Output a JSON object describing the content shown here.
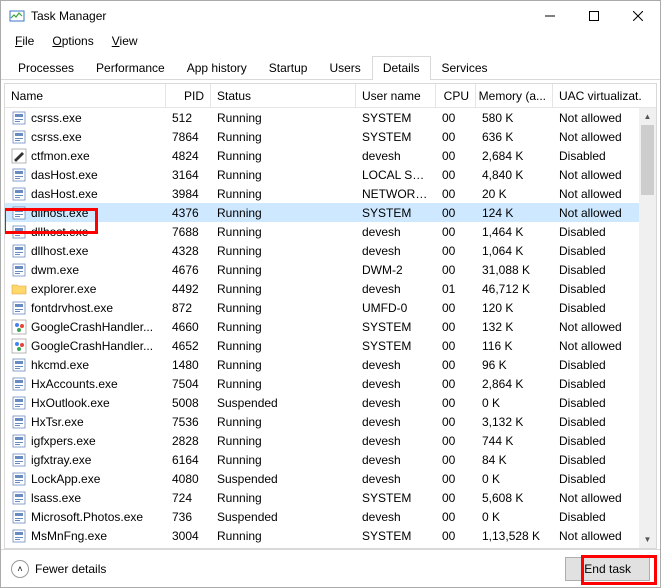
{
  "window": {
    "title": "Task Manager"
  },
  "menu": {
    "file": "File",
    "options": "Options",
    "view": "View"
  },
  "tabs": {
    "processes": "Processes",
    "performance": "Performance",
    "apphistory": "App history",
    "startup": "Startup",
    "users": "Users",
    "details": "Details",
    "services": "Services"
  },
  "columns": {
    "name": "Name",
    "pid": "PID",
    "status": "Status",
    "user": "User name",
    "cpu": "CPU",
    "mem": "Memory (a...",
    "uac": "UAC virtualizat..."
  },
  "rows": [
    {
      "icon": "exe",
      "name": "csrss.exe",
      "pid": "512",
      "status": "Running",
      "user": "SYSTEM",
      "cpu": "00",
      "mem": "580 K",
      "uac": "Not allowed"
    },
    {
      "icon": "exe",
      "name": "csrss.exe",
      "pid": "7864",
      "status": "Running",
      "user": "SYSTEM",
      "cpu": "00",
      "mem": "636 K",
      "uac": "Not allowed"
    },
    {
      "icon": "pen",
      "name": "ctfmon.exe",
      "pid": "4824",
      "status": "Running",
      "user": "devesh",
      "cpu": "00",
      "mem": "2,684 K",
      "uac": "Disabled"
    },
    {
      "icon": "exe",
      "name": "dasHost.exe",
      "pid": "3164",
      "status": "Running",
      "user": "LOCAL SE...",
      "cpu": "00",
      "mem": "4,840 K",
      "uac": "Not allowed"
    },
    {
      "icon": "exe",
      "name": "dasHost.exe",
      "pid": "3984",
      "status": "Running",
      "user": "NETWORK...",
      "cpu": "00",
      "mem": "20 K",
      "uac": "Not allowed"
    },
    {
      "icon": "exe",
      "name": "dllhost.exe",
      "pid": "4376",
      "status": "Running",
      "user": "SYSTEM",
      "cpu": "00",
      "mem": "124 K",
      "uac": "Not allowed",
      "selected": true
    },
    {
      "icon": "exe",
      "name": "dllhost.exe",
      "pid": "7688",
      "status": "Running",
      "user": "devesh",
      "cpu": "00",
      "mem": "1,464 K",
      "uac": "Disabled"
    },
    {
      "icon": "exe",
      "name": "dllhost.exe",
      "pid": "4328",
      "status": "Running",
      "user": "devesh",
      "cpu": "00",
      "mem": "1,064 K",
      "uac": "Disabled"
    },
    {
      "icon": "exe",
      "name": "dwm.exe",
      "pid": "4676",
      "status": "Running",
      "user": "DWM-2",
      "cpu": "00",
      "mem": "31,088 K",
      "uac": "Disabled"
    },
    {
      "icon": "folder",
      "name": "explorer.exe",
      "pid": "4492",
      "status": "Running",
      "user": "devesh",
      "cpu": "01",
      "mem": "46,712 K",
      "uac": "Disabled"
    },
    {
      "icon": "exe",
      "name": "fontdrvhost.exe",
      "pid": "872",
      "status": "Running",
      "user": "UMFD-0",
      "cpu": "00",
      "mem": "120 K",
      "uac": "Disabled"
    },
    {
      "icon": "color",
      "name": "GoogleCrashHandler...",
      "pid": "4660",
      "status": "Running",
      "user": "SYSTEM",
      "cpu": "00",
      "mem": "132 K",
      "uac": "Not allowed"
    },
    {
      "icon": "color",
      "name": "GoogleCrashHandler...",
      "pid": "4652",
      "status": "Running",
      "user": "SYSTEM",
      "cpu": "00",
      "mem": "116 K",
      "uac": "Not allowed"
    },
    {
      "icon": "exe",
      "name": "hkcmd.exe",
      "pid": "1480",
      "status": "Running",
      "user": "devesh",
      "cpu": "00",
      "mem": "96 K",
      "uac": "Disabled"
    },
    {
      "icon": "exe",
      "name": "HxAccounts.exe",
      "pid": "7504",
      "status": "Running",
      "user": "devesh",
      "cpu": "00",
      "mem": "2,864 K",
      "uac": "Disabled"
    },
    {
      "icon": "exe",
      "name": "HxOutlook.exe",
      "pid": "5008",
      "status": "Suspended",
      "user": "devesh",
      "cpu": "00",
      "mem": "0 K",
      "uac": "Disabled"
    },
    {
      "icon": "exe",
      "name": "HxTsr.exe",
      "pid": "7536",
      "status": "Running",
      "user": "devesh",
      "cpu": "00",
      "mem": "3,132 K",
      "uac": "Disabled"
    },
    {
      "icon": "exe",
      "name": "igfxpers.exe",
      "pid": "2828",
      "status": "Running",
      "user": "devesh",
      "cpu": "00",
      "mem": "744 K",
      "uac": "Disabled"
    },
    {
      "icon": "exe",
      "name": "igfxtray.exe",
      "pid": "6164",
      "status": "Running",
      "user": "devesh",
      "cpu": "00",
      "mem": "84 K",
      "uac": "Disabled"
    },
    {
      "icon": "exe",
      "name": "LockApp.exe",
      "pid": "4080",
      "status": "Suspended",
      "user": "devesh",
      "cpu": "00",
      "mem": "0 K",
      "uac": "Disabled"
    },
    {
      "icon": "exe",
      "name": "lsass.exe",
      "pid": "724",
      "status": "Running",
      "user": "SYSTEM",
      "cpu": "00",
      "mem": "5,608 K",
      "uac": "Not allowed"
    },
    {
      "icon": "exe",
      "name": "Microsoft.Photos.exe",
      "pid": "736",
      "status": "Suspended",
      "user": "devesh",
      "cpu": "00",
      "mem": "0 K",
      "uac": "Disabled"
    },
    {
      "icon": "exe",
      "name": "MsMnFng.exe",
      "pid": "3004",
      "status": "Running",
      "user": "SYSTEM",
      "cpu": "00",
      "mem": "1,13,528 K",
      "uac": "Not allowed"
    }
  ],
  "footer": {
    "fewer": "Fewer details",
    "end_task": "End task"
  }
}
